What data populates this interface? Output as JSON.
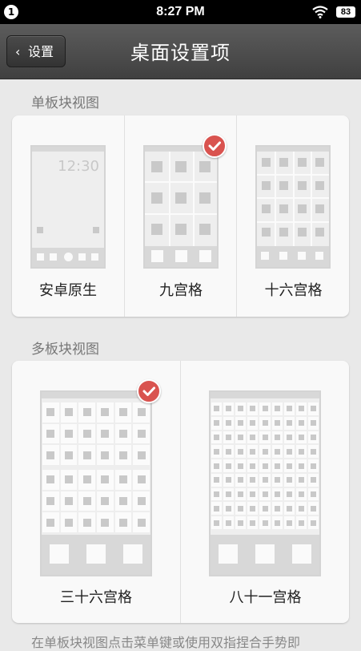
{
  "status_bar": {
    "notification_count": "1",
    "time": "8:27 PM",
    "battery": "83"
  },
  "header": {
    "back_label": "设置",
    "title": "桌面设置项"
  },
  "single_panel": {
    "section_title": "单板块视图",
    "options": [
      {
        "label": "安卓原生",
        "clock": "12:30",
        "selected": false
      },
      {
        "label": "九宫格",
        "selected": true
      },
      {
        "label": "十六宫格",
        "selected": false
      }
    ]
  },
  "multi_panel": {
    "section_title": "多板块视图",
    "options": [
      {
        "label": "三十六宫格",
        "selected": true
      },
      {
        "label": "八十一宫格",
        "selected": false
      }
    ]
  },
  "footer_note": "在单板块视图点击菜单键或使用双指捏合手势即",
  "colors": {
    "accent": "#d9534f",
    "header_bg": "#4a4a4a",
    "card_bg": "#f9f9f9"
  }
}
